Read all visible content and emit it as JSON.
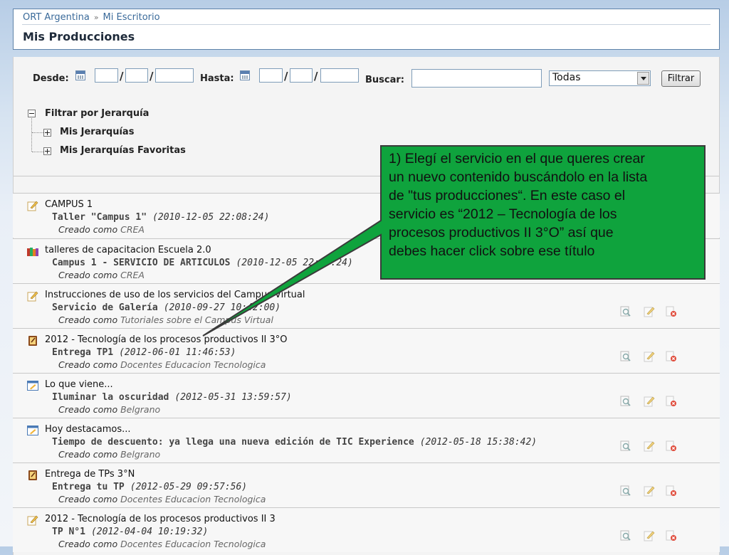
{
  "header": {
    "breadcrumb": [
      "ORT Argentina",
      "Mi Escritorio"
    ],
    "breadcrumb_sep": "»",
    "title": "Mis Producciones"
  },
  "filters": {
    "desde_label": "Desde:",
    "hasta_label": "Hasta:",
    "buscar_label": "Buscar:",
    "date_sep": "/",
    "buscar_value": "",
    "select_value": "Todas",
    "filter_button": "Filtrar"
  },
  "tree": {
    "root": "Filtrar por Jerarquía",
    "children": [
      "Mis Jerarquías",
      "Mis Jerarquías Favoritas"
    ]
  },
  "items": [
    {
      "service": "CAMPUS 1",
      "title": "Taller \"Campus 1\"",
      "date": "(2010-12-05 22:08:24)",
      "created_prefix": "Creado como",
      "created_as": "CREA",
      "icon": "edit-note-icon"
    },
    {
      "service": "talleres de capacitacion Escuela 2.0",
      "title": "Campus 1 - SERVICIO DE ARTICULOS",
      "date": "(2010-12-05 22:08:24)",
      "created_prefix": "Creado como",
      "created_as": "CREA",
      "icon": "books-icon"
    },
    {
      "service": "Instrucciones de uso de los servicios del Campus Virtual",
      "title": "Servicio de Galería",
      "date": "(2010-09-27 10:42:00)",
      "created_prefix": "Creado como",
      "created_as": "Tutoriales sobre el Campus Virtual",
      "icon": "edit-note-icon"
    },
    {
      "service": "2012 - Tecnología de los procesos productivos II 3°O",
      "title": "Entrega TP1",
      "date": "(2012-06-01 11:46:53)",
      "created_prefix": "Creado como",
      "created_as": "Docentes Educacion Tecnologica",
      "icon": "assignment-icon"
    },
    {
      "service": "Lo que viene...",
      "title": "Iluminar la oscuridad",
      "date": "(2012-05-31 13:59:57)",
      "created_prefix": "Creado como",
      "created_as": "Belgrano",
      "icon": "blog-icon"
    },
    {
      "service": "Hoy destacamos...",
      "title": "Tiempo de descuento: ya llega una nueva edición de TIC Experience",
      "date": "(2012-05-18 15:38:42)",
      "created_prefix": "Creado como",
      "created_as": "Belgrano",
      "icon": "blog-icon"
    },
    {
      "service": "Entrega de TPs 3°N",
      "title": "Entrega tu TP",
      "date": "(2012-05-29 09:57:56)",
      "created_prefix": "Creado como",
      "created_as": "Docentes Educacion Tecnologica",
      "icon": "assignment-icon"
    },
    {
      "service": "2012 - Tecnología de los procesos productivos II 3",
      "title": "TP N°1",
      "date": "(2012-04-04 10:19:32)",
      "created_prefix": "Creado como",
      "created_as": "Docentes Educacion Tecnologica",
      "icon": "edit-note-icon"
    }
  ],
  "callout": {
    "lines": [
      "1) Elegí el servicio en el que queres crear",
      "un nuevo contenido buscándolo en la lista",
      "de \"tus producciones“. En este caso el",
      "servicio es “2012 – Tecnología de los",
      "procesos productivos II 3°O” así que",
      "debes hacer click sobre ese título"
    ],
    "fill": "#0fa33d",
    "stroke": "#3a3a3a"
  },
  "colors": {
    "link": "#3a6a9a",
    "header_border": "#5e82a8"
  }
}
